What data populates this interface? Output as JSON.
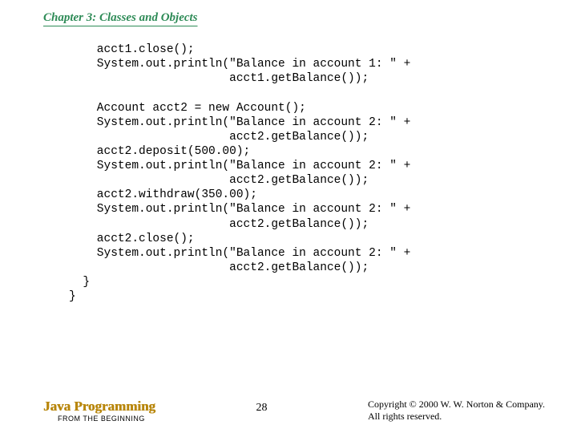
{
  "chapter": "Chapter 3: Classes and Objects",
  "code": "    acct1.close();\n    System.out.println(\"Balance in account 1: \" +\n                       acct1.getBalance());\n\n    Account acct2 = new Account();\n    System.out.println(\"Balance in account 2: \" +\n                       acct2.getBalance());\n    acct2.deposit(500.00);\n    System.out.println(\"Balance in account 2: \" +\n                       acct2.getBalance());\n    acct2.withdraw(350.00);\n    System.out.println(\"Balance in account 2: \" +\n                       acct2.getBalance());\n    acct2.close();\n    System.out.println(\"Balance in account 2: \" +\n                       acct2.getBalance());\n  }\n}",
  "footer": {
    "book_title": "Java Programming",
    "book_subtitle": "FROM THE BEGINNING",
    "page": "28",
    "copyright_line1": "Copyright © 2000 W. W. Norton & Company.",
    "copyright_line2": "All rights reserved."
  }
}
